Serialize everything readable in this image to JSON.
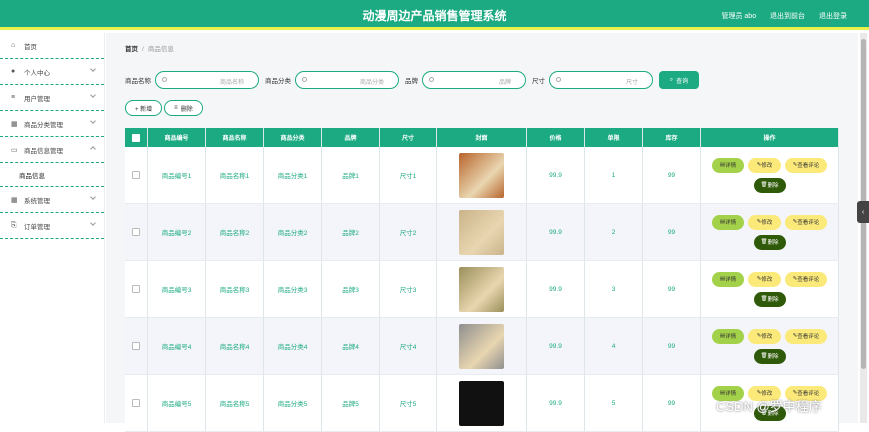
{
  "header": {
    "title": "动漫周边产品销售管理系统",
    "user": "管理员 abo",
    "back_label": "退出到前台",
    "logout_label": "退出登录"
  },
  "sidebar": {
    "items": [
      {
        "label": "首页",
        "icon": "home-icon"
      },
      {
        "label": "个人中心",
        "icon": "user-icon"
      },
      {
        "label": "用户管理",
        "icon": "sliders-icon"
      },
      {
        "label": "商品分类管理",
        "icon": "grid-icon"
      },
      {
        "label": "商品信息管理",
        "icon": "chat-icon"
      },
      {
        "label": "商品信息",
        "icon": ""
      },
      {
        "label": "系统管理",
        "icon": "grid-icon"
      },
      {
        "label": "订单管理",
        "icon": "clipboard-icon"
      }
    ]
  },
  "breadcrumb": {
    "home": "首页",
    "current": "商品信息"
  },
  "search": {
    "name_label": "商品名称",
    "name_placeholder": "商品名称",
    "category_label": "商品分类",
    "category_placeholder": "商品分类",
    "brand_label": "品牌",
    "brand_placeholder": "品牌",
    "size_label": "尺寸",
    "size_placeholder": "尺寸",
    "button": "查询"
  },
  "actions": {
    "add": "+ 新增",
    "delete": "删除"
  },
  "table": {
    "headers": [
      "商品编号",
      "商品名称",
      "商品分类",
      "品牌",
      "尺寸",
      "封面",
      "价格",
      "单限",
      "库存",
      "操作"
    ],
    "rows": [
      {
        "code": "商品编号1",
        "name": "商品名称1",
        "category": "商品分类1",
        "brand": "品牌1",
        "size": "尺寸1",
        "price": "99.9",
        "limit": "1",
        "stock": "99",
        "cover_color": "#b8642c"
      },
      {
        "code": "商品编号2",
        "name": "商品名称2",
        "category": "商品分类2",
        "brand": "品牌2",
        "size": "尺寸2",
        "price": "99.9",
        "limit": "2",
        "stock": "99",
        "cover_color": "#c9b38a"
      },
      {
        "code": "商品编号3",
        "name": "商品名称3",
        "category": "商品分类3",
        "brand": "品牌3",
        "size": "尺寸3",
        "price": "99.9",
        "limit": "3",
        "stock": "99",
        "cover_color": "#9a8f5a"
      },
      {
        "code": "商品编号4",
        "name": "商品名称4",
        "category": "商品分类4",
        "brand": "品牌4",
        "size": "尺寸4",
        "price": "99.9",
        "limit": "4",
        "stock": "99",
        "cover_color": "#8f8f8f"
      },
      {
        "code": "商品编号5",
        "name": "商品名称5",
        "category": "商品分类5",
        "brand": "品牌5",
        "size": "尺寸5",
        "price": "99.9",
        "limit": "5",
        "stock": "99",
        "cover_color": "#111111"
      }
    ],
    "op_labels": {
      "detail": "详情",
      "edit": "修改",
      "review": "查看评论",
      "delete": "删除"
    }
  },
  "watermark": "CSDN @罗中程序",
  "colors": {
    "primary": "#1caa82",
    "accent": "#e9f24a",
    "detail": "#a4d14a",
    "edit": "#fbe97a",
    "delete": "#2f5a09"
  }
}
